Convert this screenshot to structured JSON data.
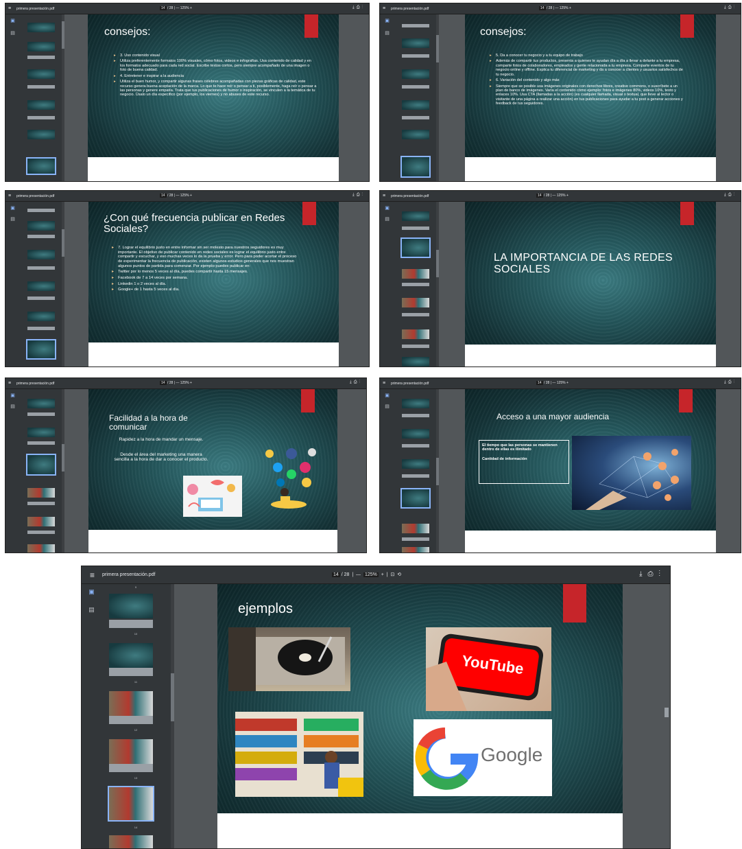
{
  "filename": "primera presentación.pdf",
  "toolbar": {
    "page_current": "14",
    "page_total": "/ 28",
    "zoom": "125%",
    "zoom_out": "—",
    "zoom_in": "+"
  },
  "slides": {
    "consejos_a": {
      "title": "consejos:",
      "bullets": [
        "3. Uso contenido visual",
        "Utiliza preferentemente formatos 100% visuales, cómo fotos, videos e infografías. Usa contenido de calidad y en los formatos adecuado para cada red social. Escribe textos cortos, pero siempre acompañado de una imagen o foto de buena calidad.",
        "4. Entretener e inspirar a la audiencia",
        "Utiliza el buen humor, y compartir algunas frases célebres acompañadas con piezas gráficas de calidad, este recurso genera buena aceptación de la marca. Lo que te hace reír o pensar a ti, posiblemente, haga reír o pensar a las personas y genere empatía. Trata que tus publicaciones de humor o inspiración, se vinculen a la temática de tu negocio. Úsalo un día especifico (por ejemplo, los viernes) y no abuses de este recurso."
      ]
    },
    "consejos_b": {
      "title": "consejos:",
      "bullets": [
        "5. Da a conocer tu negocio y a tu equipo de trabajo",
        "Además de compartir tus productos, presenta a quienes te ayudan día a día a llevar a delante a tu empresa, comparte fotos de colaboradores, empleados y gente relacionada a tu empresa. Comparte eventos de tu negocio online y offline. Explica tu diferencial de marketing y da a conocer a clientes y usuarios satisfechos de tu negocio.",
        "6. Variación del contenido y algo más",
        "Siempre que se posible usa imágenes originales con derechos libres, creative commons, o suscríbete a un plan de banco de imágenes. Varía el contenido cómo ejemplo: fotos e imágenes 80%, videos 10%, texto y enlaces 10%. Usa CTA (llamadas a la acción) (es cualquier llamada, visual o textual, que lleve al lector o visitante de una página a realizar una acción) en tus publicaciones para ayudar a tu post a generar acciones y feedback de tus seguidores."
      ]
    },
    "frecuencia": {
      "title": "¿Con qué frecuencia publicar en Redes Sociales?",
      "bullets": [
        "7. Lograr el equilibrio justo en entre informar sin ser molesto para nuestros seguidores es muy importante. El objetivo de publicar contenido en redes sociales es lograr el equilibrio justo entre compartir y escuchar, y eso muchas veces lo da la prueba y error. Pero para poder acortar el proceso de experimentar la frecuencia de publicación, existen algunos estudios generales que nos muestran algunos puntos de partida para comenzar. Por ejemplo puedes publicar en:",
        "Twitter por lo menos 5 veces al día, puedes compartir hasta 15 mensajes.",
        "Facebook de 7 a 14 veces por semana.",
        "Linkedin 1 o 2 veces al día.",
        "Google+ de 1 hasta 5 veces al día."
      ]
    },
    "importancia": {
      "title": "LA IMPORTANCIA DE LAS REDES SOCIALES"
    },
    "facilidad": {
      "title": "Facilidad a la hora de comunicar",
      "line1": "Rapidez a la hora de mandar un mensaje.",
      "line2": "Desde el área del marketing una manera sencilla a la hora de dar a conocer el producto."
    },
    "acceso": {
      "title": "Acceso a una mayor audiencia",
      "box_line1": "El tiempo que las personas se mantienen dentro de ellas es ilimitado",
      "box_line2": "Cantidad de información"
    },
    "ejemplos": {
      "title": "ejemplos",
      "youtube_text": "YouTube",
      "google_text": "Google"
    }
  },
  "thumb_numbers": [
    "9",
    "10",
    "11",
    "12",
    "13",
    "14"
  ],
  "colors": {
    "accent_red": "#c6252a",
    "toolbar": "#323639",
    "slide_teal": "#25585d"
  }
}
